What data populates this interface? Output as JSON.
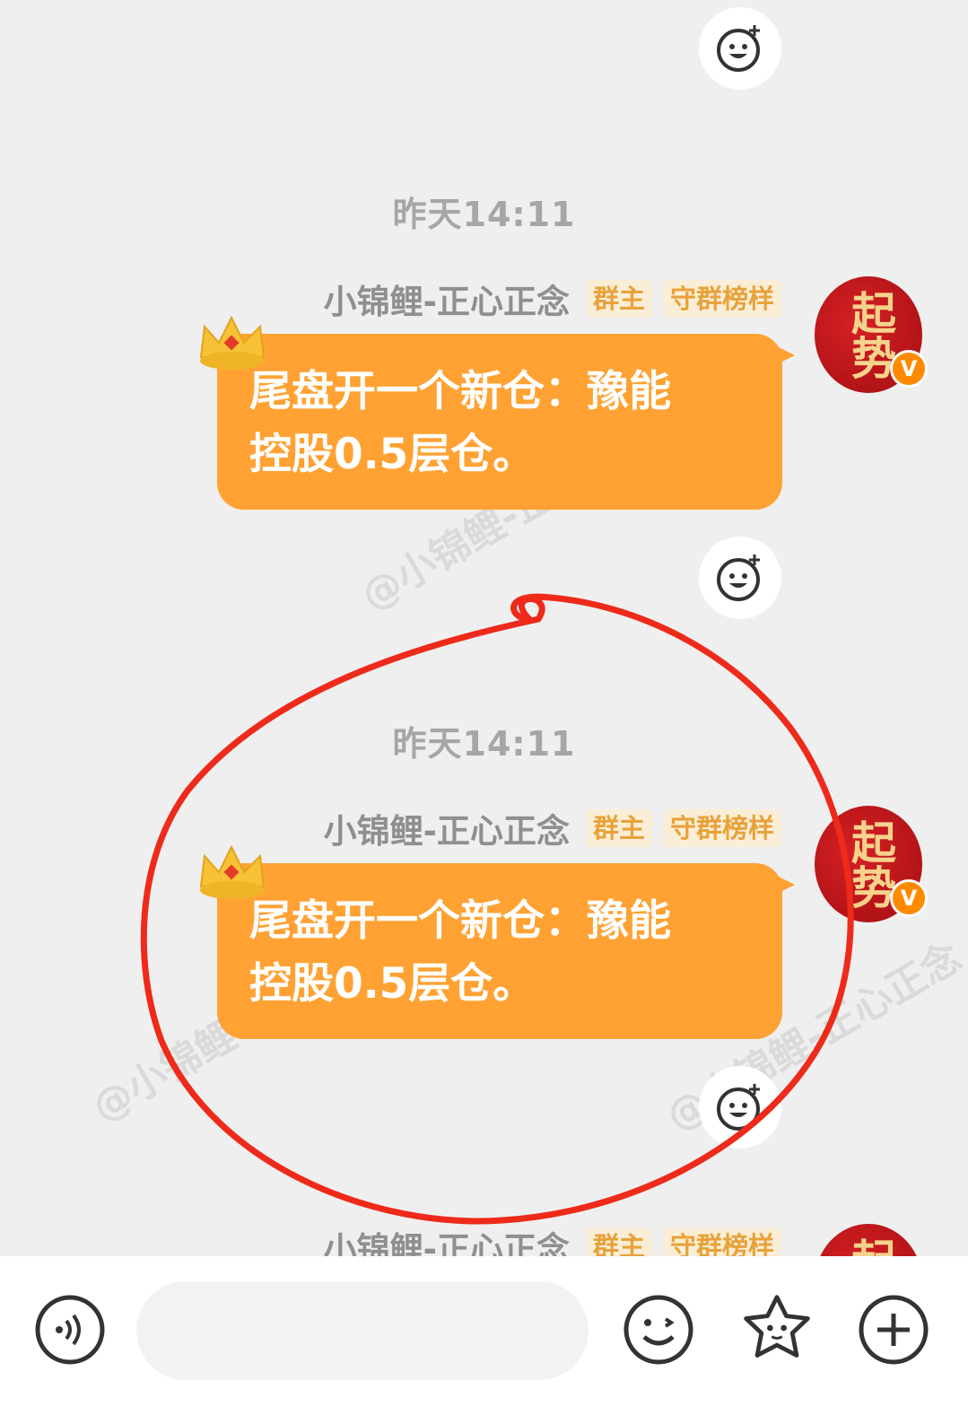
{
  "messages": [
    {
      "timestamp": "昨天14:11",
      "sender": "小锦鲤-正心正念",
      "badges": [
        "群主",
        "守群榜样"
      ],
      "text_line1": "尾盘开一个新仓：豫能",
      "text_line2": "控股0.5层仓。"
    },
    {
      "timestamp": "昨天14:11",
      "sender": "小锦鲤-正心正念",
      "badges": [
        "群主",
        "守群榜样"
      ],
      "text_line1": "尾盘开一个新仓：豫能",
      "text_line2": "控股0.5层仓。"
    },
    {
      "sender": "小锦鲤-正心正念",
      "badges": [
        "群主",
        "守群榜样"
      ]
    }
  ],
  "avatar": {
    "text": "起势",
    "verified_mark": "V"
  },
  "watermark": "@小锦鲤-正心正念",
  "composer": {
    "placeholder": ""
  },
  "icons": [
    "add-reaction-icon",
    "voice-icon",
    "emoji-icon",
    "sticker-icon",
    "plus-icon",
    "crown-icon"
  ],
  "colors": {
    "bubble": "#ffa233",
    "badge_text": "#e8a23a",
    "annotation_circle": "#ee2a1a"
  }
}
